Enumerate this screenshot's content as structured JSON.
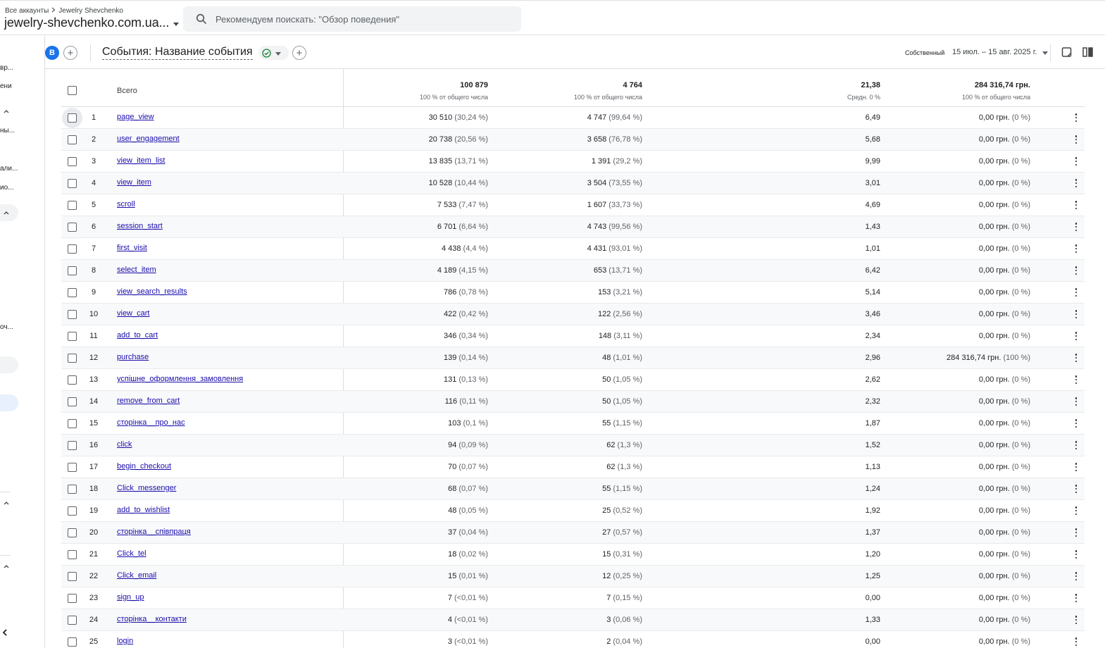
{
  "header": {
    "breadcrumb": [
      "Все аккаунты",
      "Jewelry Shevchenko"
    ],
    "account_name": "jewelry-shevchenko.com.ua...",
    "search_placeholder": "Рекомендуем поискать: \"Обзор поведения\""
  },
  "sidebar": {
    "fragments": [
      "вр...",
      "ени",
      "ны...",
      "али...",
      "ио...",
      "оч..."
    ]
  },
  "toolbar": {
    "segment_letter": "B",
    "report_title": "События: Название события",
    "date_range_label": "Собственный",
    "date_range": "15 июл. – 15 авг. 2025 г."
  },
  "table": {
    "total_label": "Всего",
    "totals": [
      {
        "value": "100 879",
        "sub": "100 % от общего числа"
      },
      {
        "value": "4 764",
        "sub": "100 % от общего числа"
      },
      {
        "value": "21,38",
        "sub": "Средн. 0 %"
      },
      {
        "value": "284 316,74 грн.",
        "sub": "100 % от общего числа"
      }
    ],
    "rows": [
      {
        "n": "1",
        "name": "page_view",
        "c1": "30 510",
        "p1": "(30,24 %)",
        "c2": "4 747",
        "p2": "(99,64 %)",
        "c3": "6,49",
        "c4": "0,00 грн.",
        "p4": "(0 %)"
      },
      {
        "n": "2",
        "name": "user_engagement",
        "c1": "20 738",
        "p1": "(20,56 %)",
        "c2": "3 658",
        "p2": "(76,78 %)",
        "c3": "5,68",
        "c4": "0,00 грн.",
        "p4": "(0 %)"
      },
      {
        "n": "3",
        "name": "view_item_list",
        "c1": "13 835",
        "p1": "(13,71 %)",
        "c2": "1 391",
        "p2": "(29,2 %)",
        "c3": "9,99",
        "c4": "0,00 грн.",
        "p4": "(0 %)"
      },
      {
        "n": "4",
        "name": "view_item",
        "c1": "10 528",
        "p1": "(10,44 %)",
        "c2": "3 504",
        "p2": "(73,55 %)",
        "c3": "3,01",
        "c4": "0,00 грн.",
        "p4": "(0 %)"
      },
      {
        "n": "5",
        "name": "scroll",
        "c1": "7 533",
        "p1": "(7,47 %)",
        "c2": "1 607",
        "p2": "(33,73 %)",
        "c3": "4,69",
        "c4": "0,00 грн.",
        "p4": "(0 %)"
      },
      {
        "n": "6",
        "name": "session_start",
        "c1": "6 701",
        "p1": "(6,64 %)",
        "c2": "4 743",
        "p2": "(99,56 %)",
        "c3": "1,43",
        "c4": "0,00 грн.",
        "p4": "(0 %)"
      },
      {
        "n": "7",
        "name": "first_visit",
        "c1": "4 438",
        "p1": "(4,4 %)",
        "c2": "4 431",
        "p2": "(93,01 %)",
        "c3": "1,01",
        "c4": "0,00 грн.",
        "p4": "(0 %)"
      },
      {
        "n": "8",
        "name": "select_item",
        "c1": "4 189",
        "p1": "(4,15 %)",
        "c2": "653",
        "p2": "(13,71 %)",
        "c3": "6,42",
        "c4": "0,00 грн.",
        "p4": "(0 %)"
      },
      {
        "n": "9",
        "name": "view_search_results",
        "c1": "786",
        "p1": "(0,78 %)",
        "c2": "153",
        "p2": "(3,21 %)",
        "c3": "5,14",
        "c4": "0,00 грн.",
        "p4": "(0 %)"
      },
      {
        "n": "10",
        "name": "view_cart",
        "c1": "422",
        "p1": "(0,42 %)",
        "c2": "122",
        "p2": "(2,56 %)",
        "c3": "3,46",
        "c4": "0,00 грн.",
        "p4": "(0 %)"
      },
      {
        "n": "11",
        "name": "add_to_cart",
        "c1": "346",
        "p1": "(0,34 %)",
        "c2": "148",
        "p2": "(3,11 %)",
        "c3": "2,34",
        "c4": "0,00 грн.",
        "p4": "(0 %)"
      },
      {
        "n": "12",
        "name": "purchase",
        "c1": "139",
        "p1": "(0,14 %)",
        "c2": "48",
        "p2": "(1,01 %)",
        "c3": "2,96",
        "c4": "284 316,74 грн.",
        "p4": "(100 %)"
      },
      {
        "n": "13",
        "name": "успішне_оформлення_замовлення",
        "c1": "131",
        "p1": "(0,13 %)",
        "c2": "50",
        "p2": "(1,05 %)",
        "c3": "2,62",
        "c4": "0,00 грн.",
        "p4": "(0 %)"
      },
      {
        "n": "14",
        "name": "remove_from_cart",
        "c1": "116",
        "p1": "(0,11 %)",
        "c2": "50",
        "p2": "(1,05 %)",
        "c3": "2,32",
        "c4": "0,00 грн.",
        "p4": "(0 %)"
      },
      {
        "n": "15",
        "name": "сторінка__про_нас",
        "c1": "103",
        "p1": "(0,1 %)",
        "c2": "55",
        "p2": "(1,15 %)",
        "c3": "1,87",
        "c4": "0,00 грн.",
        "p4": "(0 %)"
      },
      {
        "n": "16",
        "name": "click",
        "c1": "94",
        "p1": "(0,09 %)",
        "c2": "62",
        "p2": "(1,3 %)",
        "c3": "1,52",
        "c4": "0,00 грн.",
        "p4": "(0 %)"
      },
      {
        "n": "17",
        "name": "begin_checkout",
        "c1": "70",
        "p1": "(0,07 %)",
        "c2": "62",
        "p2": "(1,3 %)",
        "c3": "1,13",
        "c4": "0,00 грн.",
        "p4": "(0 %)"
      },
      {
        "n": "18",
        "name": "Click_messenger",
        "c1": "68",
        "p1": "(0,07 %)",
        "c2": "55",
        "p2": "(1,15 %)",
        "c3": "1,24",
        "c4": "0,00 грн.",
        "p4": "(0 %)"
      },
      {
        "n": "19",
        "name": "add_to_wishlist",
        "c1": "48",
        "p1": "(0,05 %)",
        "c2": "25",
        "p2": "(0,52 %)",
        "c3": "1,92",
        "c4": "0,00 грн.",
        "p4": "(0 %)"
      },
      {
        "n": "20",
        "name": "сторінка__співпраця",
        "c1": "37",
        "p1": "(0,04 %)",
        "c2": "27",
        "p2": "(0,57 %)",
        "c3": "1,37",
        "c4": "0,00 грн.",
        "p4": "(0 %)"
      },
      {
        "n": "21",
        "name": "Click_tel",
        "c1": "18",
        "p1": "(0,02 %)",
        "c2": "15",
        "p2": "(0,31 %)",
        "c3": "1,20",
        "c4": "0,00 грн.",
        "p4": "(0 %)"
      },
      {
        "n": "22",
        "name": "Click_email",
        "c1": "15",
        "p1": "(0,01 %)",
        "c2": "12",
        "p2": "(0,25 %)",
        "c3": "1,25",
        "c4": "0,00 грн.",
        "p4": "(0 %)"
      },
      {
        "n": "23",
        "name": "sign_up",
        "c1": "7",
        "p1": "(<0,01 %)",
        "c2": "7",
        "p2": "(0,15 %)",
        "c3": "0,00",
        "c4": "0,00 грн.",
        "p4": "(0 %)"
      },
      {
        "n": "24",
        "name": "сторінка__контакти",
        "c1": "4",
        "p1": "(<0,01 %)",
        "c2": "3",
        "p2": "(0,06 %)",
        "c3": "1,33",
        "c4": "0,00 грн.",
        "p4": "(0 %)"
      },
      {
        "n": "25",
        "name": "login",
        "c1": "3",
        "p1": "(<0,01 %)",
        "c2": "2",
        "p2": "(0,04 %)",
        "c3": "0,00",
        "c4": "0,00 грн.",
        "p4": "(0 %)"
      }
    ]
  }
}
